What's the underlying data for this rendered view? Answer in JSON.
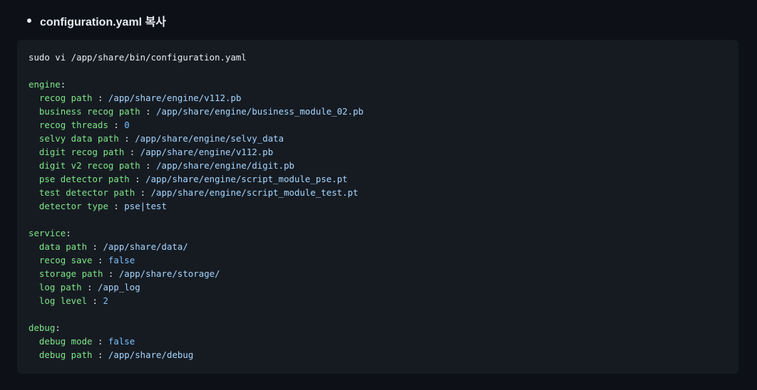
{
  "heading": {
    "text": "configuration.yaml 복사"
  },
  "code": {
    "command": "sudo vi /app/share/bin/configuration.yaml",
    "sections": [
      {
        "name": "engine",
        "entries": [
          {
            "key": "recog path",
            "value": "/app/share/engine/v112.pb",
            "kind": "str"
          },
          {
            "key": "business recog path",
            "value": "/app/share/engine/business_module_02.pb",
            "kind": "str"
          },
          {
            "key": "recog threads",
            "value": "0",
            "kind": "num"
          },
          {
            "key": "selvy data path",
            "value": "/app/share/engine/selvy_data",
            "kind": "str"
          },
          {
            "key": "digit recog path",
            "value": "/app/share/engine/v112.pb",
            "kind": "str"
          },
          {
            "key": "digit v2 recog path",
            "value": "/app/share/engine/digit.pb",
            "kind": "str"
          },
          {
            "key": "pse detector path",
            "value": "/app/share/engine/script_module_pse.pt",
            "kind": "str"
          },
          {
            "key": "test detector path",
            "value": "/app/share/engine/script_module_test.pt",
            "kind": "str"
          },
          {
            "key": "detector type",
            "value": "pse|test",
            "kind": "str"
          }
        ]
      },
      {
        "name": "service",
        "entries": [
          {
            "key": "data path",
            "value": "/app/share/data/",
            "kind": "str"
          },
          {
            "key": "recog save",
            "value": "false",
            "kind": "bool"
          },
          {
            "key": "storage path",
            "value": "/app/share/storage/",
            "kind": "str"
          },
          {
            "key": "log path",
            "value": "/app_log",
            "kind": "str"
          },
          {
            "key": "log level",
            "value": "2",
            "kind": "num"
          }
        ]
      },
      {
        "name": "debug",
        "entries": [
          {
            "key": "debug mode",
            "value": "false",
            "kind": "bool"
          },
          {
            "key": "debug path",
            "value": "/app/share/debug",
            "kind": "str"
          }
        ]
      }
    ]
  },
  "colors": {
    "background": "#0d1117",
    "code_background": "#161b22",
    "key": "#7ee787",
    "string": "#a5d6ff",
    "constant": "#79c0ff",
    "text": "#e6edf3"
  }
}
